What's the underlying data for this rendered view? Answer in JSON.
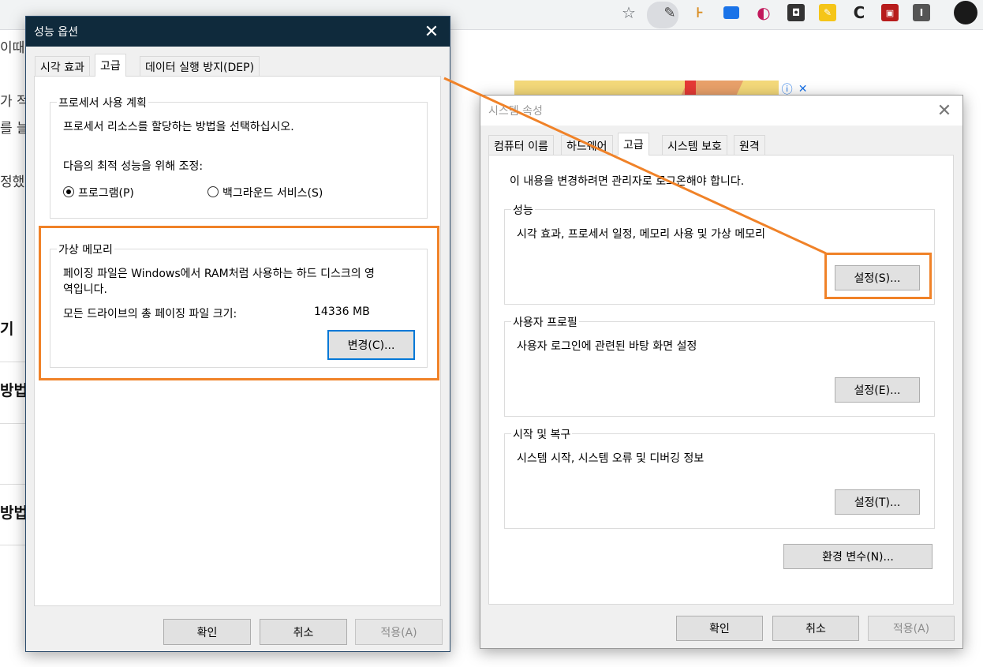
{
  "browser": {
    "icons": [
      "star-icon",
      "eyedropper-icon",
      "extension-icons",
      "profile-avatar"
    ]
  },
  "background_page": {
    "fragments": [
      "이때",
      "가 적",
      "를 늘",
      "정했",
      "기",
      "방법",
      "방법"
    ]
  },
  "performance_options": {
    "title": "성능 옵션",
    "tabs": [
      "시각 효과",
      "고급",
      "데이터 실행 방지(DEP)"
    ],
    "active_tab": "고급",
    "processor_group": {
      "title": "프로세서 사용 계획",
      "description": "프로세서 리소스를 할당하는 방법을 선택하십시오.",
      "adjust_label": "다음의 최적 성능을 위해 조정:",
      "options": [
        {
          "label": "프로그램(P)",
          "checked": true
        },
        {
          "label": "백그라운드 서비스(S)",
          "checked": false
        }
      ]
    },
    "virtual_memory": {
      "title": "가상 메모리",
      "description_line1": "페이징 파일은 Windows에서 RAM처럼 사용하는 하드 디스크의 영",
      "description_line2": "역입니다.",
      "total_label": "모든 드라이브의 총 페이징 파일 크기:",
      "total_value": "14336 MB",
      "change_button": "변경(C)..."
    },
    "buttons": {
      "ok": "확인",
      "cancel": "취소",
      "apply": "적용(A)"
    }
  },
  "system_properties": {
    "title": "시스템 속성",
    "tabs": [
      "컴퓨터 이름",
      "하드웨어",
      "고급",
      "시스템 보호",
      "원격"
    ],
    "active_tab": "고급",
    "admin_notice": "이 내용을 변경하려면 관리자로 로그온해야 합니다.",
    "performance": {
      "title": "성능",
      "description": "시각 효과, 프로세서 일정, 메모리 사용 및 가상 메모리",
      "button": "설정(S)..."
    },
    "user_profile": {
      "title": "사용자 프로필",
      "description": "사용자 로그인에 관련된 바탕 화면 설정",
      "button": "설정(E)..."
    },
    "startup_recovery": {
      "title": "시작 및 복구",
      "description": "시스템 시작, 시스템 오류 및 디버깅 정보",
      "button": "설정(T)..."
    },
    "env_button": "환경 변수(N)...",
    "buttons": {
      "ok": "확인",
      "cancel": "취소",
      "apply": "적용(A)"
    }
  },
  "colors": {
    "highlight": "#f08228",
    "perf_titlebar": "#0f2a3c",
    "focus_border": "#0078d7"
  }
}
